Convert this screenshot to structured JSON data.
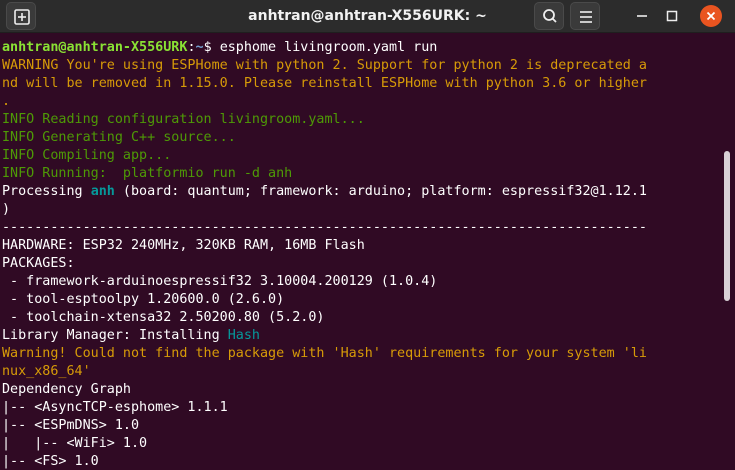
{
  "window": {
    "title": "anhtran@anhtran-X556URK: ~",
    "accent": "#e95420",
    "background": "#300a24",
    "icons": [
      "new-tab-icon",
      "search-icon",
      "menu-icon",
      "minimize-icon",
      "maximize-icon",
      "close-icon"
    ]
  },
  "terminal": {
    "prompt_user": "anhtran@anhtran-X556URK",
    "prompt_sep": ":",
    "prompt_path": "~",
    "prompt_dollar": "$ ",
    "command": "esphome livingroom.yaml run",
    "lines": [
      {
        "segments": [
          {
            "text": "WARNING You're using ESPHome with python 2. Support for python 2 is deprecated a",
            "color": "#d79b08"
          }
        ]
      },
      {
        "segments": [
          {
            "text": "nd will be removed in 1.15.0. Please reinstall ESPHome with python 3.6 or higher",
            "color": "#d79b08"
          }
        ]
      },
      {
        "segments": [
          {
            "text": ".",
            "color": "#d79b08"
          }
        ]
      },
      {
        "segments": [
          {
            "text": "INFO Reading configuration livingroom.yaml...",
            "color": "#4e9a06"
          }
        ]
      },
      {
        "segments": [
          {
            "text": "INFO Generating C++ source...",
            "color": "#4e9a06"
          }
        ]
      },
      {
        "segments": [
          {
            "text": "INFO Compiling app...",
            "color": "#4e9a06"
          }
        ]
      },
      {
        "segments": [
          {
            "text": "INFO Running:  platformio run -d anh",
            "color": "#4e9a06"
          }
        ]
      },
      {
        "segments": [
          {
            "text": "Processing ",
            "color": "#ffffff"
          },
          {
            "text": "anh",
            "color": "#06989a",
            "bold": true
          },
          {
            "text": " (board: quantum; framework: arduino; platform: espressif32@1.12.1",
            "color": "#ffffff"
          }
        ]
      },
      {
        "segments": [
          {
            "text": ")",
            "color": "#ffffff"
          }
        ]
      },
      {
        "segments": [
          {
            "text": "--------------------------------------------------------------------------------",
            "color": "#ffffff"
          }
        ]
      },
      {
        "segments": [
          {
            "text": "HARDWARE: ESP32 240MHz, 320KB RAM, 16MB Flash",
            "color": "#ffffff"
          }
        ]
      },
      {
        "segments": [
          {
            "text": "PACKAGES:",
            "color": "#ffffff"
          }
        ]
      },
      {
        "segments": [
          {
            "text": " - framework-arduinoespressif32 3.10004.200129 (1.0.4)",
            "color": "#ffffff"
          }
        ]
      },
      {
        "segments": [
          {
            "text": " - tool-esptoolpy 1.20600.0 (2.6.0)",
            "color": "#ffffff"
          }
        ]
      },
      {
        "segments": [
          {
            "text": " - toolchain-xtensa32 2.50200.80 (5.2.0)",
            "color": "#ffffff"
          }
        ]
      },
      {
        "segments": [
          {
            "text": "Library Manager: Installing ",
            "color": "#ffffff"
          },
          {
            "text": "Hash",
            "color": "#06989a"
          }
        ]
      },
      {
        "segments": [
          {
            "text": "Warning! Could not find the package with 'Hash' requirements for your system 'li",
            "color": "#d79b08"
          }
        ]
      },
      {
        "segments": [
          {
            "text": "nux_x86_64'",
            "color": "#d79b08"
          }
        ]
      },
      {
        "segments": [
          {
            "text": "Dependency Graph",
            "color": "#ffffff"
          }
        ]
      },
      {
        "segments": [
          {
            "text": "|-- <AsyncTCP-esphome> 1.1.1",
            "color": "#ffffff"
          }
        ]
      },
      {
        "segments": [
          {
            "text": "|-- <ESPmDNS> 1.0",
            "color": "#ffffff"
          }
        ]
      },
      {
        "segments": [
          {
            "text": "|   |-- <WiFi> 1.0",
            "color": "#ffffff"
          }
        ]
      },
      {
        "segments": [
          {
            "text": "|-- <FS> 1.0",
            "color": "#ffffff"
          }
        ]
      }
    ]
  }
}
